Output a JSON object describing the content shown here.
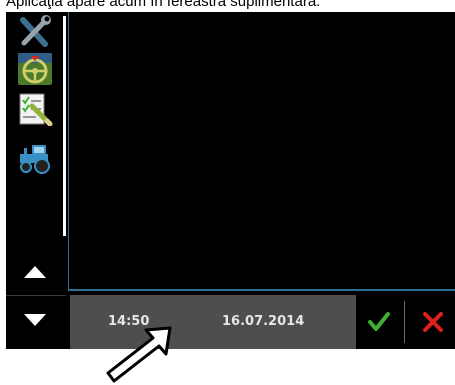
{
  "caption": {
    "text": "Aplicaţia apare acum în fereastra suplimentară."
  },
  "sidebar": {
    "items": [
      {
        "icon": "wrench-screwdriver-icon"
      },
      {
        "icon": "steering-wheel-icon"
      },
      {
        "icon": "checklist-notepad-icon"
      },
      {
        "icon": "tractor-icon"
      }
    ],
    "scroll_up_icon": "triangle-up-icon",
    "scroll_down_icon": "triangle-down-icon"
  },
  "statusbar": {
    "time": "14:50",
    "date": "16.07.2014"
  },
  "actions": {
    "confirm_icon": "checkmark-icon",
    "cancel_icon": "cross-icon"
  },
  "colors": {
    "background": "#000000",
    "statusbar": "#4e4e4e",
    "confirm": "#3fb02f",
    "cancel": "#e0201b",
    "accent_border": "#2e6f92"
  }
}
